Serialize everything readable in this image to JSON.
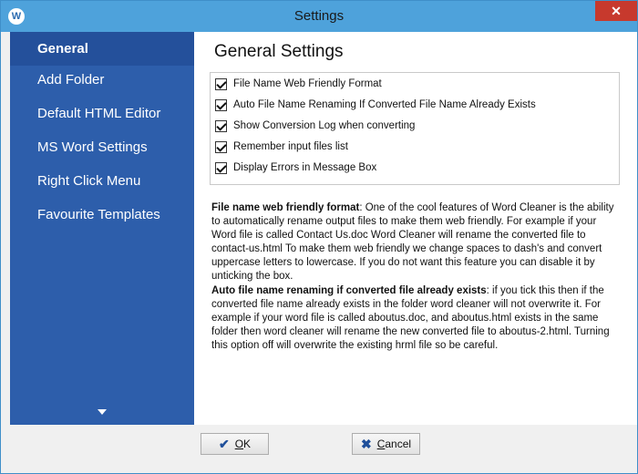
{
  "window": {
    "title": "Settings",
    "app_icon_letter": "W",
    "close_glyph": "✕"
  },
  "sidebar": {
    "items": [
      {
        "label": "General",
        "active": true
      },
      {
        "label": "Add Folder"
      },
      {
        "label": "Default HTML Editor"
      },
      {
        "label": "MS Word Settings"
      },
      {
        "label": "Right Click Menu"
      },
      {
        "label": "Favourite Templates"
      }
    ],
    "scroll_icon": "chevron-down-icon"
  },
  "main": {
    "heading": "General Settings",
    "options": [
      {
        "label": "File Name Web Friendly Format",
        "checked": true
      },
      {
        "label": "Auto File Name Renaming If Converted File Name Already Exists",
        "checked": true
      },
      {
        "label": "Show Conversion Log when converting",
        "checked": true
      },
      {
        "label": "Remember input files list",
        "checked": true
      },
      {
        "label": "Display Errors in Message Box",
        "checked": true
      }
    ],
    "desc1": {
      "term": "File name web friendly format",
      "text": ": One of the cool features of Word Cleaner is the ability to automatically rename output files to make them web friendly. For example if your Word file is called Contact Us.doc Word Cleaner will rename the converted file to contact-us.html To make them web friendly we change spaces to dash's and convert uppercase letters to lowercase. If you do not want this feature you can disable it by unticking the box."
    },
    "desc2": {
      "term": "Auto file name renaming if converted file already exists",
      "text": ": if you tick this then if the converted file name already exists in the folder word cleaner will not overwrite it. For example if your word file is called aboutus.doc, and aboutus.html exists in the same folder then word cleaner will rename the new converted file to aboutus-2.html. Turning this option off will overwrite the existing hrml file so be careful."
    }
  },
  "footer": {
    "ok_label_underlined": "O",
    "ok_label_rest": "K",
    "cancel_label_underlined": "C",
    "cancel_label_rest": "ancel",
    "ok_icon": "✔",
    "cancel_icon": "✖"
  }
}
